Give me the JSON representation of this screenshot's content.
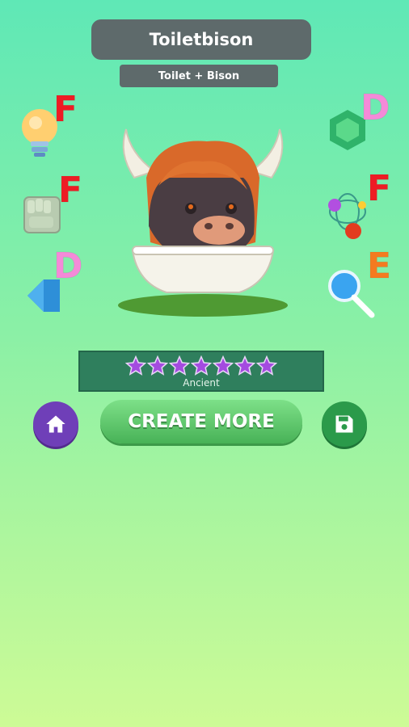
{
  "creature": {
    "name": "Toiletbison",
    "recipe": "Toilet + Bison"
  },
  "stats": {
    "left": [
      {
        "icon": "lightbulb-icon",
        "grade": "F",
        "grade_color": "#ee1c24"
      },
      {
        "icon": "fist-icon",
        "grade": "F",
        "grade_color": "#ee1c24"
      },
      {
        "icon": "arrow-left-icon",
        "grade": "D",
        "grade_color": "#f48ad8"
      }
    ],
    "right": [
      {
        "icon": "gem-icon",
        "grade": "D",
        "grade_color": "#f48ad8"
      },
      {
        "icon": "orbit-icon",
        "grade": "F",
        "grade_color": "#ee1c24"
      },
      {
        "icon": "magnifier-icon",
        "grade": "E",
        "grade_color": "#f47a20"
      }
    ]
  },
  "rarity": {
    "stars_filled": 7,
    "stars_total": 7,
    "label": "Ancient",
    "star_color": "#a44be0"
  },
  "actions": {
    "home_icon": "home-icon",
    "create_label": "CREATE MORE",
    "save_icon": "floppy-disk-icon"
  },
  "colors": {
    "title_bg": "#5e6a6b",
    "rarity_bg": "#2f7f5d",
    "create_btn": "#5cc56b",
    "home_btn": "#6f3fb8",
    "save_btn": "#2b9a4a"
  }
}
